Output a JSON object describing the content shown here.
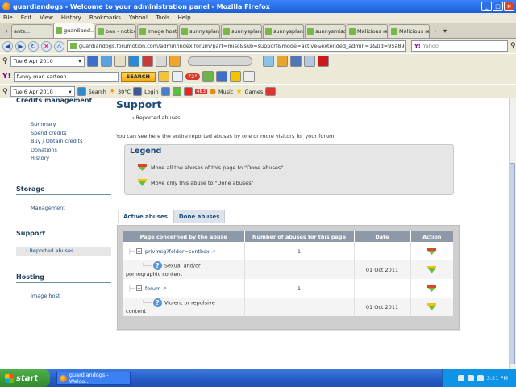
{
  "window": {
    "title": "guardiandogs - Welcome to your administration panel - Mozilla Firefox"
  },
  "menu": [
    "File",
    "Edit",
    "View",
    "History",
    "Bookmarks",
    "Yahoo!",
    "Tools",
    "Help"
  ],
  "browser_tabs": [
    {
      "label": "ants..."
    },
    {
      "label": "guardiand...",
      "active": true
    },
    {
      "label": "ban - notice"
    },
    {
      "label": "Image hostin..."
    },
    {
      "label": "sunnysplan.j..."
    },
    {
      "label": "sunnysplan.j..."
    },
    {
      "label": "sunnysplan2...."
    },
    {
      "label": "sunnysmischi..."
    },
    {
      "label": "Malicious rep..."
    },
    {
      "label": "Malicious rep..."
    }
  ],
  "nav": {
    "url": "guardiandogs.forumotion.com/admin/index.forum?part=misc&sub=support&mode=active&extended_admin=1&tid=95a89d5",
    "search_placeholder": "Yahoo"
  },
  "toolbar1": {
    "date": "Tue 6 Apr 2010"
  },
  "toolbar2": {
    "search_value": "funny man cartoon",
    "search_button": "SEARCH",
    "temp": "72°"
  },
  "toolbar3": {
    "date": "Tue 6 Apr 2010",
    "search_label": "Search",
    "weather": "30°C",
    "login": "Login",
    "music": "Music",
    "games": "Games",
    "badge": "483"
  },
  "sidebar": {
    "credits": {
      "title": "Credits management",
      "items": [
        "Summary",
        "Spend credits",
        "Buy / Obtain credits",
        "Donations",
        "History"
      ]
    },
    "storage": {
      "title": "Storage",
      "items": [
        "Management"
      ]
    },
    "support": {
      "title": "Support",
      "items": [
        "Reported abuses"
      ]
    },
    "hosting": {
      "title": "Hosting",
      "items": [
        "Image host"
      ]
    }
  },
  "main": {
    "title": "Support",
    "breadcrumb": "Reported abuses",
    "intro": "You can see here the entire reported abuses by one or more visitors for your forum.",
    "legend": {
      "title": "Legend",
      "row1": "Move all the abuses of this page to \"Done abuses\"",
      "row2": "Move only this abuse to \"Done abuses\""
    },
    "tabs": {
      "active": "Active abuses",
      "done": "Done abuses"
    },
    "table": {
      "headers": [
        "Page concerned by the abuse",
        "Number of abuses for this page",
        "Date",
        "Action"
      ],
      "groups": [
        {
          "page": "privmsg?folder=sentbox",
          "count": "1",
          "reason_line1": "Sexual and/or",
          "reason_line2": "pornographic content",
          "date": "01 Oct 2011"
        },
        {
          "page": "forum",
          "count": "1",
          "reason_line1": "Violent or repulsive",
          "reason_line2": "content",
          "date": "01 Oct 2011"
        }
      ]
    }
  },
  "taskbar": {
    "start": "start",
    "item": "guardiandogs - Welco...",
    "clock": "3:21 PM"
  }
}
